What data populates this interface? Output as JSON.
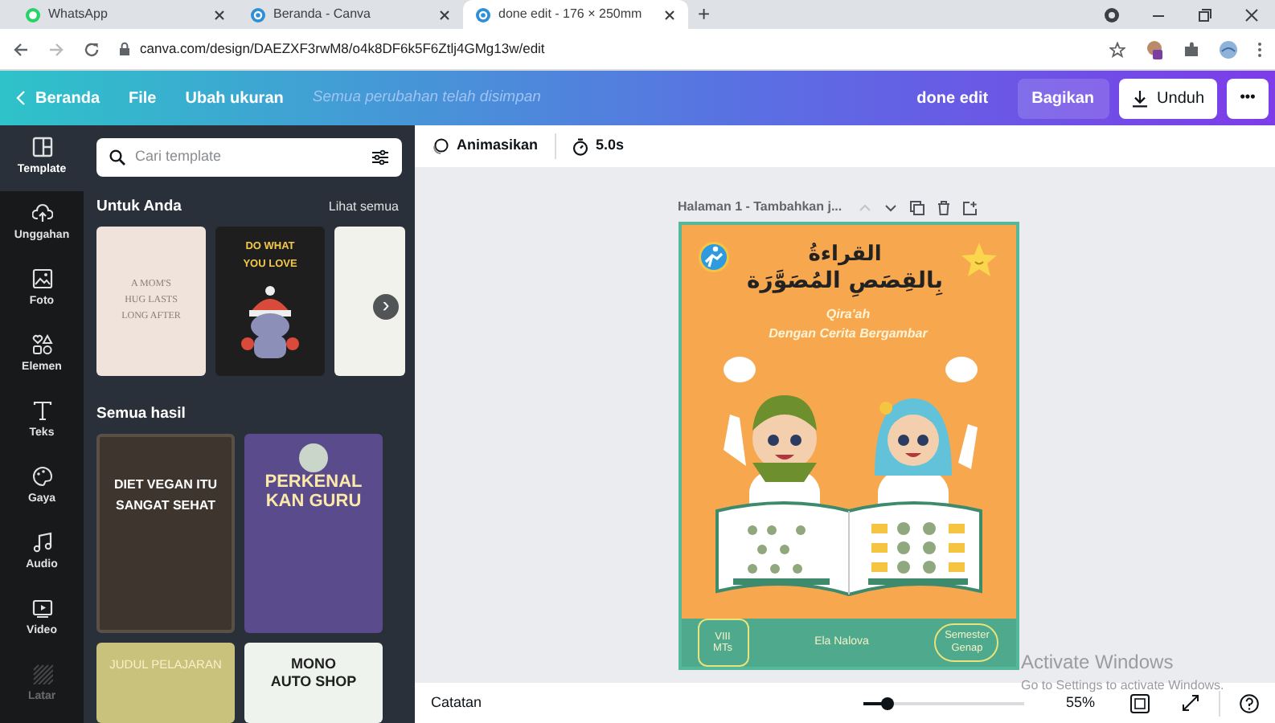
{
  "browser": {
    "tabs": [
      {
        "title": "WhatsApp",
        "kind": "whatsapp",
        "selected": false
      },
      {
        "title": "Beranda - Canva",
        "kind": "canva",
        "selected": false
      },
      {
        "title": "done edit - 176 × 250mm",
        "kind": "canva",
        "selected": true
      }
    ],
    "new_tab": "+",
    "url": "canva.com/design/DAEZXF3rwM8/o4k8DF6k5F6Ztlj4GMg13w/edit"
  },
  "header": {
    "back": "Beranda",
    "menu": [
      "File",
      "Ubah ukuran"
    ],
    "save_status": "Semua perubahan telah disimpan",
    "doc_title": "done edit",
    "share": "Bagikan",
    "download": "Unduh",
    "more": "•••"
  },
  "rail": [
    {
      "label": "Template",
      "selected": true,
      "disabled": false
    },
    {
      "label": "Unggahan",
      "selected": false,
      "disabled": false
    },
    {
      "label": "Foto",
      "selected": false,
      "disabled": false
    },
    {
      "label": "Elemen",
      "selected": false,
      "disabled": false
    },
    {
      "label": "Teks",
      "selected": false,
      "disabled": false
    },
    {
      "label": "Gaya",
      "selected": false,
      "disabled": false
    },
    {
      "label": "Audio",
      "selected": false,
      "disabled": false
    },
    {
      "label": "Video",
      "selected": false,
      "disabled": false
    },
    {
      "label": "Latar",
      "selected": false,
      "disabled": true
    }
  ],
  "panel": {
    "search": {
      "placeholder": "Cari template"
    },
    "section_1": {
      "title": "Untuk Anda",
      "see_all": "Lihat semua",
      "next": "›",
      "templates": [
        {
          "kind": "pastel",
          "lines": [
            "A MOM'S",
            "HUG LASTS",
            "LONG AFTER"
          ]
        },
        {
          "kind": "dark",
          "lines": [
            "DO WHAT",
            "YOU LOVE"
          ]
        },
        {
          "kind": "light"
        }
      ]
    },
    "section_2": {
      "title": "Semua hasil",
      "templates": [
        {
          "kind": "vegan",
          "lines": [
            "DIET VEGAN ITU",
            "SANGAT SEHAT"
          ]
        },
        {
          "kind": "teacher",
          "lines": [
            "PERKENAL",
            "KAN GURU"
          ]
        },
        {
          "kind": "lesson",
          "lines": [
            "JUDUL PELAJARAN"
          ]
        },
        {
          "kind": "shop",
          "lines": [
            "MONO",
            "AUTO SHOP"
          ]
        }
      ]
    }
  },
  "editor": {
    "animate": "Animasikan",
    "duration": "5.0s",
    "page_header": "Halaman 1 - Tambahkan j...",
    "design": {
      "title_lines": [
        "القراءةُ",
        "بِالقِصَصِ المُصَوَّرَة"
      ],
      "subtitle_lines": [
        "Qira'ah",
        "Dengan Cerita Bergambar"
      ],
      "grade": [
        "VIII",
        "MTs"
      ],
      "author": "Ela Nalova",
      "semester": [
        "Semester",
        "Genap"
      ]
    }
  },
  "bottom_bar": {
    "notes": "Catatan",
    "zoom": {
      "level": 0.15,
      "reading": "55%"
    }
  },
  "activation": {
    "title": "Activate Windows",
    "message": "Go to Settings to activate Windows."
  }
}
